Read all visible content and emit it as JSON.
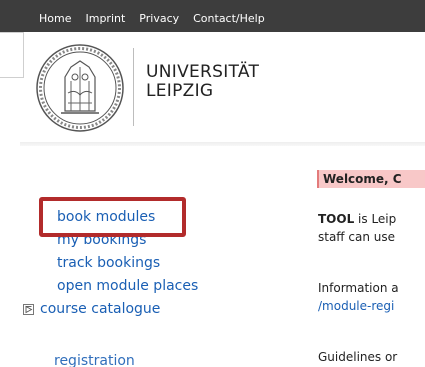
{
  "nav": {
    "items": [
      "Home",
      "Imprint",
      "Privacy",
      "Contact/Help"
    ]
  },
  "logo": {
    "line1": "UNIVERSITÄT",
    "line2": "LEIPZIG"
  },
  "sidebar": {
    "items": [
      {
        "label": "book modules"
      },
      {
        "label": "my bookings"
      },
      {
        "label": "track bookings"
      },
      {
        "label": "open module places"
      },
      {
        "label": "course catalogue",
        "icon": "expand-icon"
      }
    ],
    "partial_label": "registration"
  },
  "main": {
    "welcome": "Welcome, C",
    "para1": {
      "strong": "TOOL",
      "rest": " is Leip",
      "line2": "staff can use"
    },
    "para2": {
      "line1": "Information a",
      "link": "/module-regi"
    },
    "para3": "Guidelines or"
  },
  "colors": {
    "topbar": "#3d3d3d",
    "link": "#1a5fb4",
    "highlight": "#b22b2b",
    "welcome_bg": "#f8c8c8"
  }
}
